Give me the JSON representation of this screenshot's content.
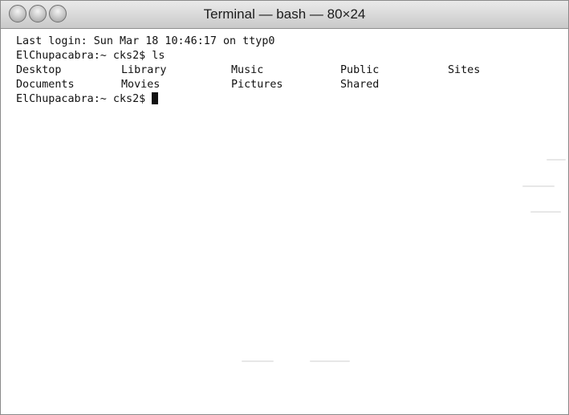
{
  "window": {
    "title": "Terminal — bash — 80×24",
    "controls": [
      "close-button",
      "minimize-button",
      "zoom-button"
    ]
  },
  "terminal": {
    "last_login": "Last login: Sun Mar 18 10:46:17 on ttyp0",
    "prompt_command": "ElChupacabra:~ cks2$ ls",
    "ls_output": {
      "row1": [
        "Desktop",
        "Library",
        "Music",
        "Public",
        "Sites"
      ],
      "row2": [
        "Documents",
        "Movies",
        "Pictures",
        "Shared"
      ]
    },
    "current_prompt": "ElChupacabra:~ cks2$ "
  }
}
